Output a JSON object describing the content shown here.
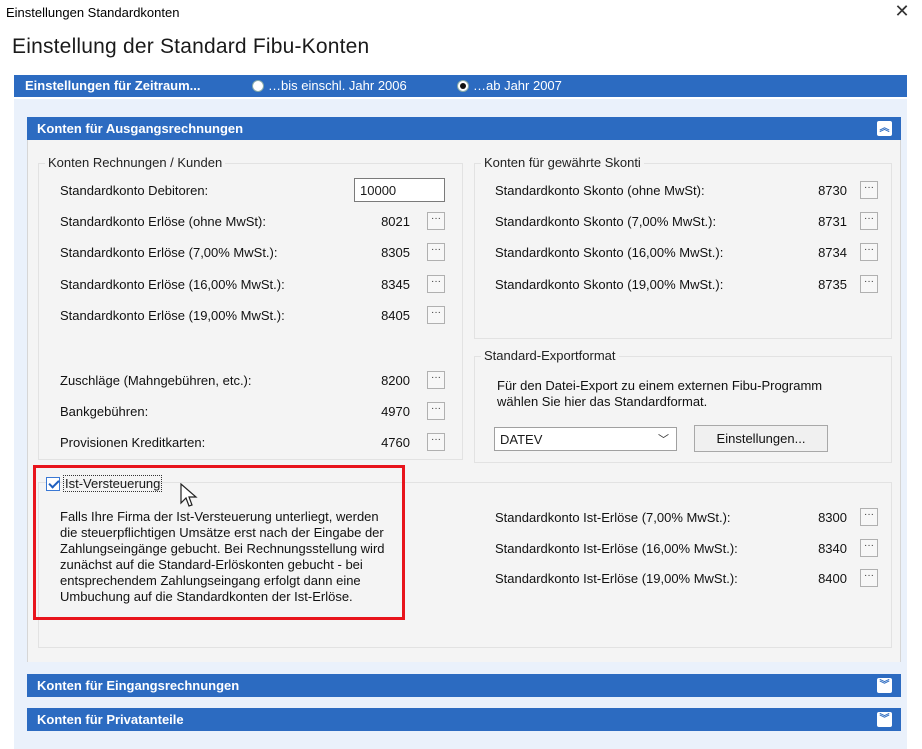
{
  "window": {
    "title": "Einstellungen Standardkonten",
    "close_icon": "close-icon"
  },
  "heading": "Einstellung der Standard Fibu-Konten",
  "period": {
    "label": "Einstellungen für Zeitraum...",
    "option1": "…bis einschl. Jahr 2006",
    "option2": "…ab Jahr 2007",
    "selected": "option2"
  },
  "sections": {
    "ausgang": {
      "title": "Konten für Ausgangsrechnungen",
      "icon": "chevron-up-icon"
    },
    "eingang": {
      "title": "Konten für Eingangsrechnungen",
      "icon": "chevron-down-icon"
    },
    "privat": {
      "title": "Konten für Privatanteile",
      "icon": "chevron-down-icon"
    }
  },
  "kunden": {
    "title": "Konten Rechnungen / Kunden",
    "debitoren_label": "Standardkonto Debitoren:",
    "debitoren_value": "10000",
    "rows": [
      {
        "label": "Standardkonto Erlöse (ohne MwSt):",
        "value": "8021"
      },
      {
        "label": "Standardkonto Erlöse (7,00% MwSt.):",
        "value": "8305"
      },
      {
        "label": "Standardkonto Erlöse (16,00% MwSt.):",
        "value": "8345"
      },
      {
        "label": "Standardkonto Erlöse (19,00% MwSt.):",
        "value": "8405"
      }
    ],
    "extra_rows": [
      {
        "label": "Zuschläge (Mahngebühren, etc.):",
        "value": "8200"
      },
      {
        "label": "Bankgebühren:",
        "value": "4970"
      },
      {
        "label": "Provisionen Kreditkarten:",
        "value": "4760"
      }
    ]
  },
  "skonti": {
    "title": "Konten für gewährte Skonti",
    "rows": [
      {
        "label": "Standardkonto Skonto (ohne MwSt):",
        "value": "8730"
      },
      {
        "label": "Standardkonto Skonto (7,00% MwSt.):",
        "value": "8731"
      },
      {
        "label": "Standardkonto Skonto (16,00% MwSt.):",
        "value": "8734"
      },
      {
        "label": "Standardkonto Skonto (19,00% MwSt.):",
        "value": "8735"
      }
    ]
  },
  "export": {
    "title": "Standard-Exportformat",
    "description_line1": "Für den Datei-Export zu einem externen Fibu-Programm",
    "description_line2": "wählen Sie hier das Standardformat.",
    "format_value": "DATEV",
    "settings_button": "Einstellungen..."
  },
  "ist": {
    "checkbox_label": "Ist-Versteuerung",
    "checked": true,
    "description_lines": [
      "Falls Ihre Firma der Ist-Versteuerung unterliegt, werden",
      "die steuerpflichtigen Umsätze erst nach der Eingabe der",
      "Zahlungseingänge gebucht. Bei Rechnungsstellung wird",
      "zunächst auf die Standard-Erlöskonten gebucht - bei",
      "entsprechendem Zahlungseingang erfolgt dann eine",
      "Umbuchung auf die Standardkonten der Ist-Erlöse."
    ],
    "rows": [
      {
        "label": "Standardkonto Ist-Erlöse (7,00% MwSt.):",
        "value": "8300"
      },
      {
        "label": "Standardkonto Ist-Erlöse (16,00% MwSt.):",
        "value": "8340"
      },
      {
        "label": "Standardkonto Ist-Erlöse (19,00% MwSt.):",
        "value": "8400"
      }
    ]
  },
  "dots_label": "···",
  "colors": {
    "accent": "#2c6bc1",
    "highlight": "#e8141c",
    "panel": "#f4f4f4"
  }
}
